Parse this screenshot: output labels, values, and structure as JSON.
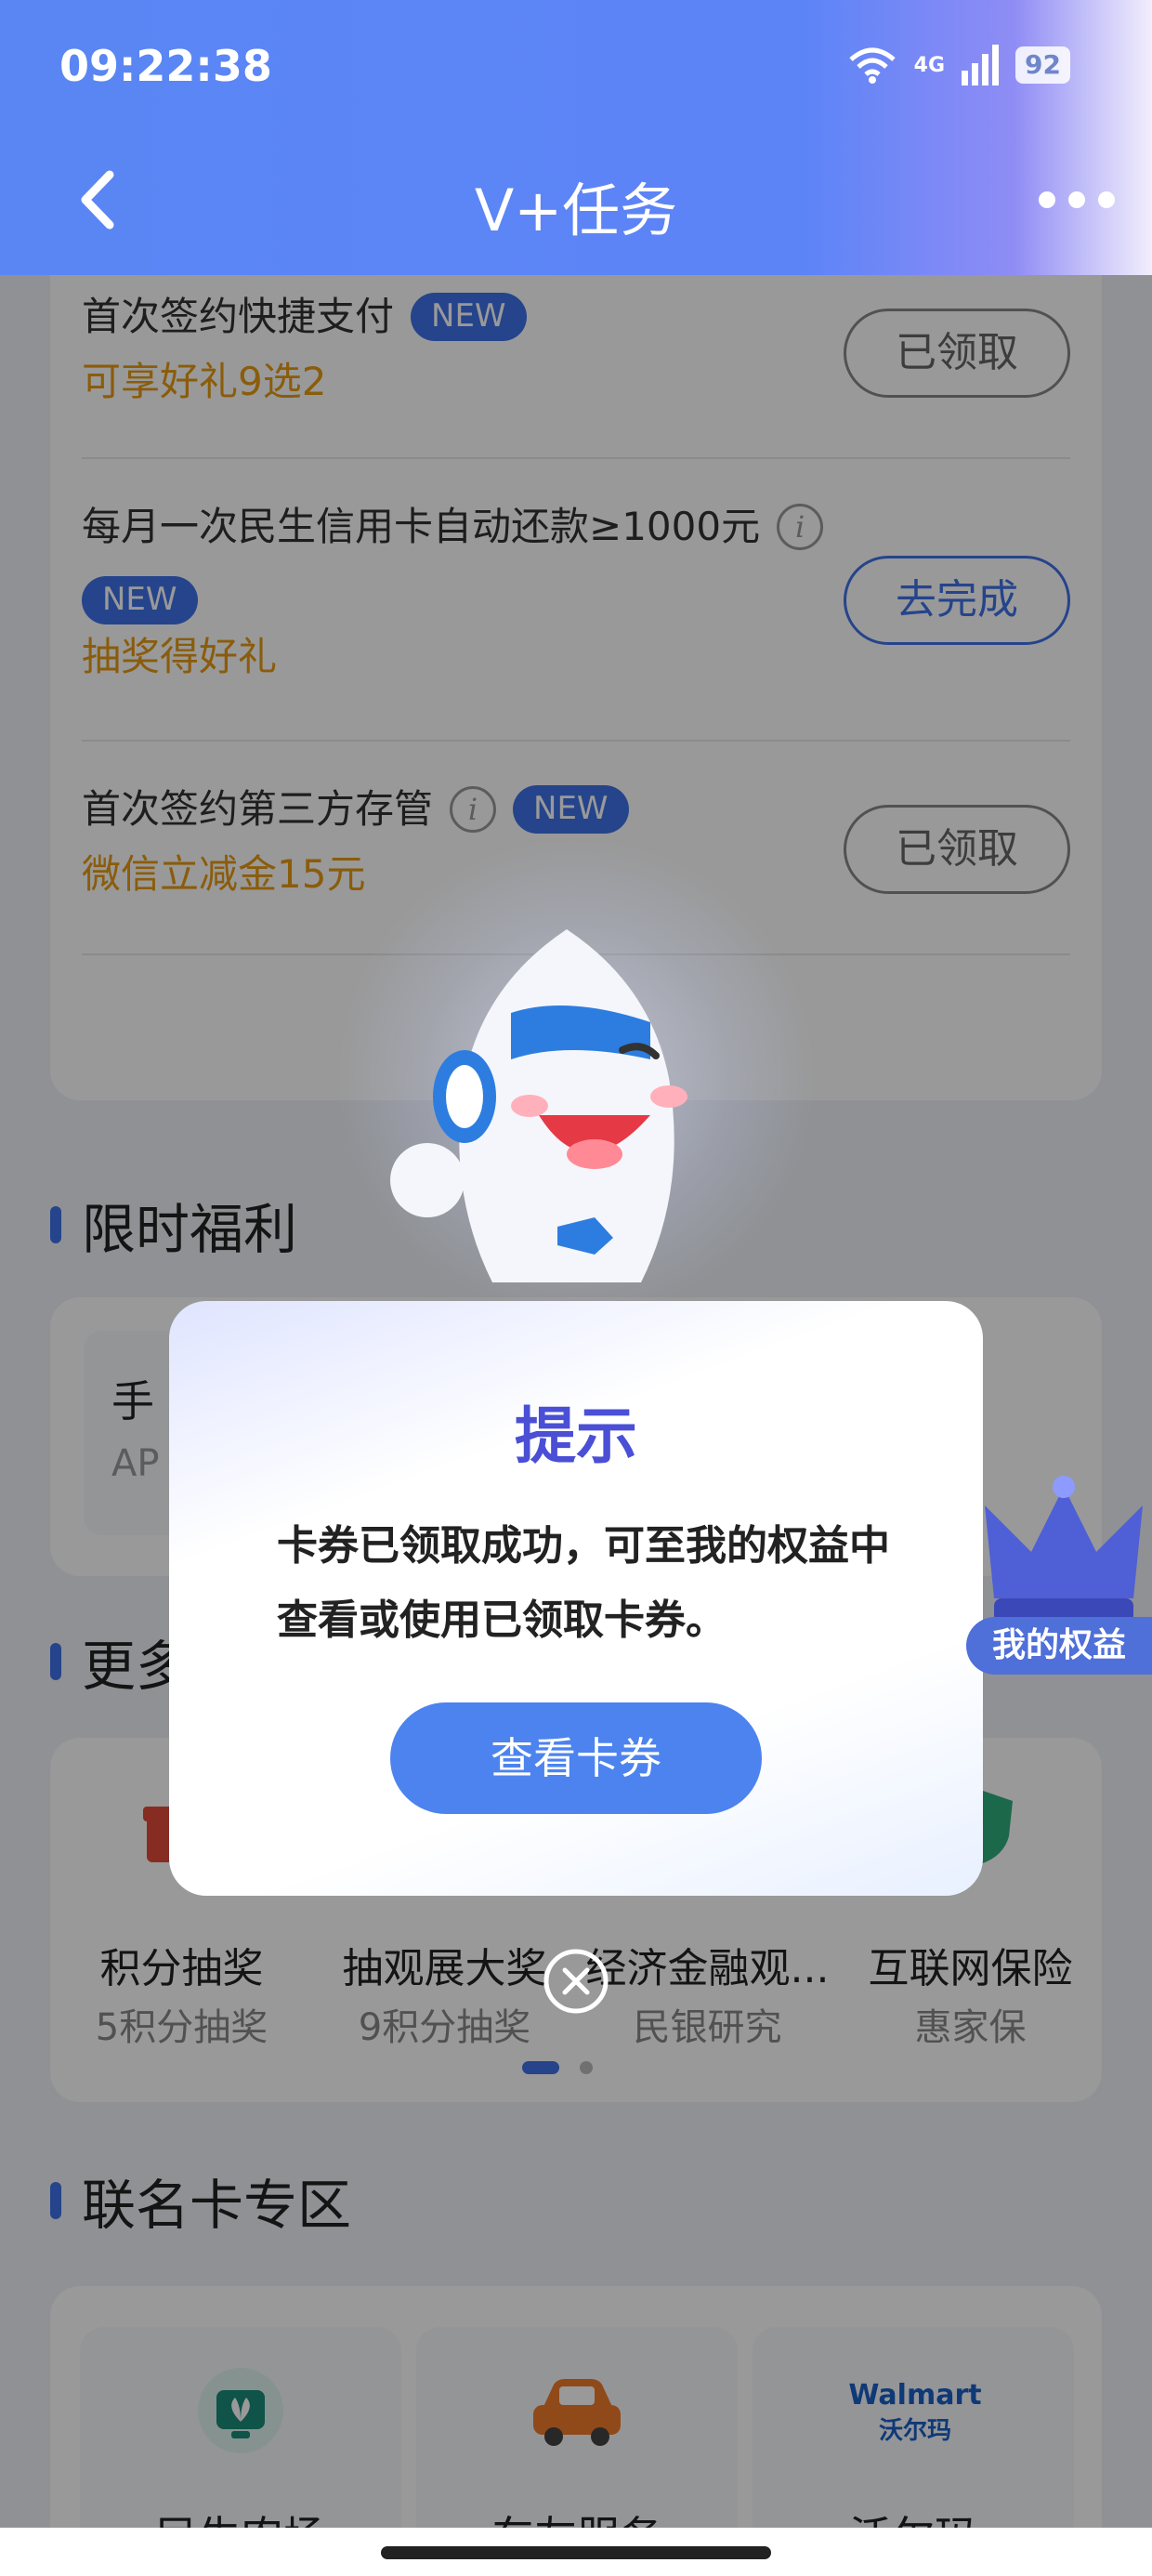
{
  "status": {
    "time": "09:22:38",
    "network": "4G",
    "battery": "92"
  },
  "nav": {
    "title": "V+任务"
  },
  "tasks": [
    {
      "title": "首次签约快捷支付",
      "badge": "NEW",
      "subtitle": "可享好礼9选2",
      "button": "已领取"
    },
    {
      "title": "每月一次民生信用卡自动还款≥1000元",
      "badge": "NEW",
      "subtitle": "抽奖得好礼",
      "button": "去完成"
    },
    {
      "title": "首次签约第三方存管",
      "badge": "NEW",
      "subtitle": "微信立减金15元",
      "button": "已领取"
    }
  ],
  "sections": {
    "limited": "限时福利",
    "more": "更多",
    "cobrand": "联名卡专区"
  },
  "limited_card": {
    "title": "手",
    "sub": "AP"
  },
  "more_items": [
    {
      "label": "积分抽奖",
      "sub": "5积分抽奖"
    },
    {
      "label": "抽观展大奖",
      "sub": "9积分抽奖"
    },
    {
      "label": "经济金融观...",
      "sub": "民银研究"
    },
    {
      "label": "互联网保险",
      "sub": "惠家保"
    }
  ],
  "cobrand_items": [
    {
      "label": "民生农场"
    },
    {
      "label": "车友服务"
    },
    {
      "label": "沃尔玛",
      "logo_text": "Walmart",
      "logo_sub": "沃尔玛"
    }
  ],
  "dialog": {
    "title": "提示",
    "message": "卡券已领取成功，可至我的权益中查看或使用已领取卡券。",
    "button": "查看卡券"
  },
  "floating": {
    "label": "我的权益"
  },
  "colors": {
    "primary": "#3f72e8",
    "accent": "#e79a13",
    "dialog_title": "#4a4fd6"
  }
}
